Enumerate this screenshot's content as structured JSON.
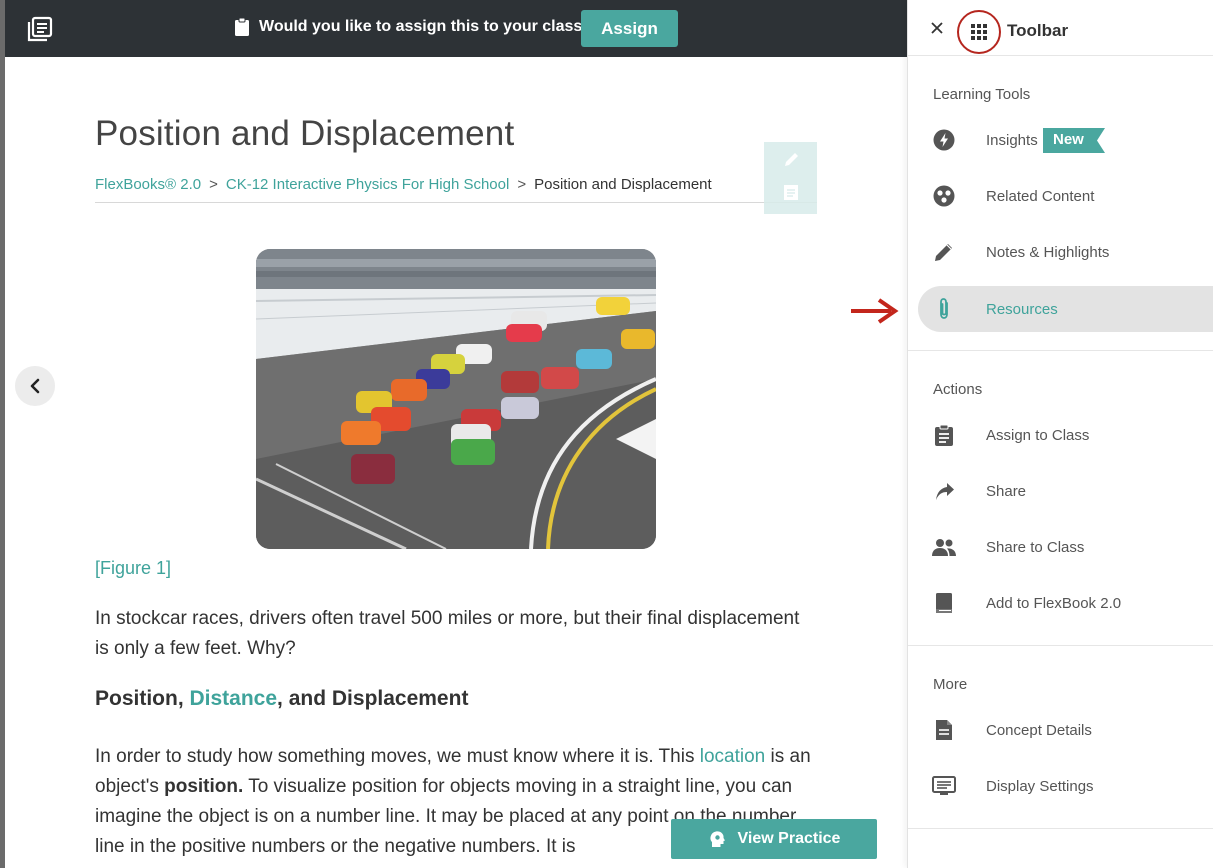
{
  "topbar": {
    "assign_prompt": "Would you like to assign this to your class?",
    "assign_button": "Assign"
  },
  "article": {
    "title": "Position and Displacement",
    "breadcrumb": [
      "FlexBooks® 2.0",
      "CK-12 Interactive Physics For High School",
      "Position and Displacement"
    ],
    "breadcrumb_separator": ">",
    "figure_caption": "[Figure 1]",
    "intro_paragraph": "In stockcar races, drivers often travel 500 miles or more, but their final displacement is only a few feet. Why?",
    "section_heading": {
      "part1": "Position, ",
      "highlight": "Distance",
      "part2": ", and Displacement"
    },
    "body_paragraph": {
      "text1": "In order to study how something moves, we must know where it is. This ",
      "link": "location",
      "text2": " is an object's ",
      "bold": "position.",
      "text3": " To visualize position for objects moving in a straight line, you can imagine the object is on a number line. It may be placed at any point on the number line in the positive numbers or the negative numbers.  It is"
    }
  },
  "view_practice_label": "View Practice",
  "toolbar": {
    "title": "Toolbar",
    "sections": [
      {
        "title": "Learning Tools",
        "items": [
          {
            "label": "Insights",
            "icon": "bolt-icon",
            "badge": "New"
          },
          {
            "label": "Related Content",
            "icon": "related-content-icon"
          },
          {
            "label": "Notes & Highlights",
            "icon": "pencil-icon"
          },
          {
            "label": "Resources",
            "icon": "paperclip-icon",
            "active": true
          }
        ]
      },
      {
        "title": "Actions",
        "items": [
          {
            "label": "Assign to Class",
            "icon": "clipboard-icon"
          },
          {
            "label": "Share",
            "icon": "share-arrow-icon"
          },
          {
            "label": "Share to Class",
            "icon": "people-icon"
          },
          {
            "label": "Add to FlexBook 2.0",
            "icon": "book-icon"
          }
        ]
      },
      {
        "title": "More",
        "items": [
          {
            "label": "Concept Details",
            "icon": "document-icon"
          },
          {
            "label": "Display Settings",
            "icon": "display-settings-icon"
          }
        ]
      }
    ]
  },
  "colors": {
    "accent": "#4aa79f",
    "topbar_bg": "#2d3236",
    "annotation_red": "#b5261e"
  }
}
